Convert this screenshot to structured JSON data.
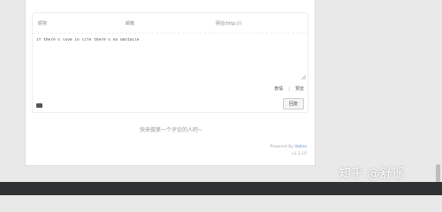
{
  "comment_form": {
    "nick_placeholder": "昵称",
    "mail_placeholder": "邮箱",
    "link_placeholder": "网址(http://)",
    "comment_text": "if there's love in life there's no obstacle",
    "expression_label": "表情",
    "preview_label": "预览",
    "submit_label": "回复"
  },
  "empty_message": "快来做第一个评论的人吧~",
  "footer": {
    "powered_prefix": "Powered By ",
    "powered_brand": "Valine",
    "version": "v1.2.10"
  },
  "watermark": "知乎 @舒遥",
  "colors": {
    "page_background": "#e9e9e9",
    "card_background": "#ffffff",
    "footer_bar": "#2f3132",
    "brand_link": "#5a8fd8"
  },
  "icons": {
    "markdown": "markdown-icon",
    "resize": "resize-handle-icon"
  }
}
